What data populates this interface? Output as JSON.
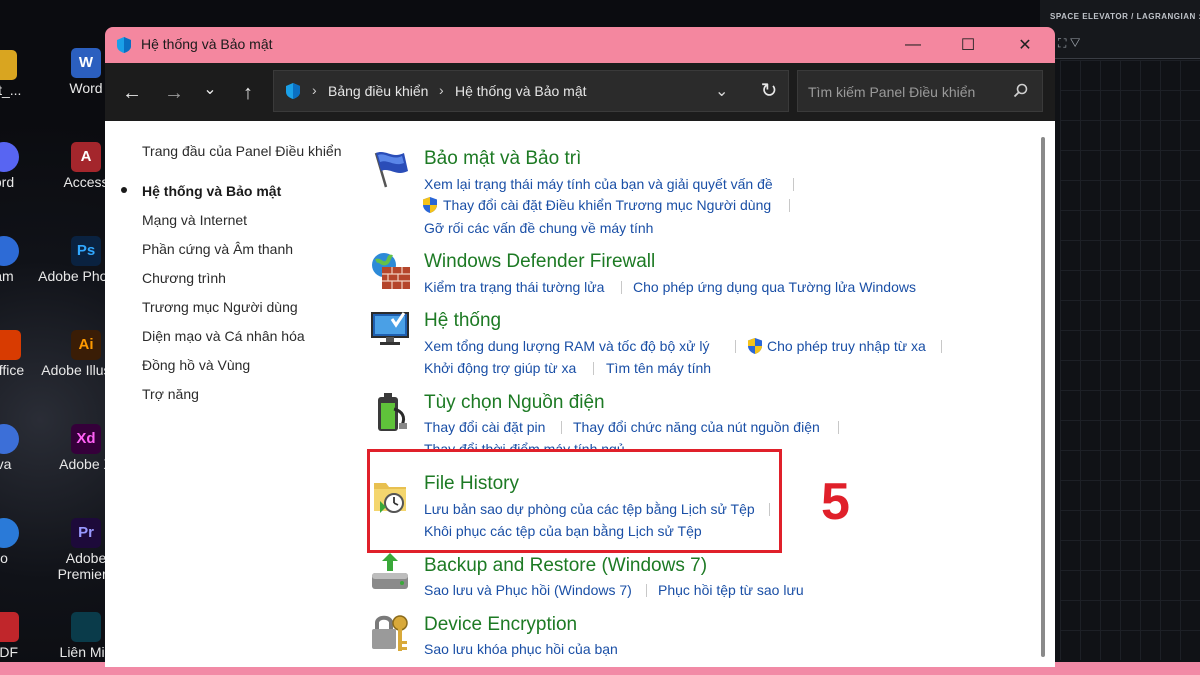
{
  "desktop": {
    "icons": [
      {
        "label": "ent_...",
        "color": "#d9a520",
        "glyph": ""
      },
      {
        "label": "Word",
        "color": "#2b5fbf",
        "glyph": "W"
      },
      {
        "label": "ord",
        "color": "#5865f2",
        "glyph": ""
      },
      {
        "label": "Access",
        "color": "#a4262c",
        "glyph": "A"
      },
      {
        "label": "am",
        "color": "#2d6bd6",
        "glyph": ""
      },
      {
        "label": "Adobe Photosh",
        "color": "#0a2240",
        "glyph": "Ps"
      },
      {
        "label": "Office",
        "color": "#d83b01",
        "glyph": ""
      },
      {
        "label": "Adobe Illustrat",
        "color": "#3a1d06",
        "glyph": "Ai"
      },
      {
        "label": "va",
        "color": "#3c6fd8",
        "glyph": ""
      },
      {
        "label": "Adobe X",
        "color": "#35003a",
        "glyph": "Xd"
      },
      {
        "label": "o",
        "color": "#2a7ad8",
        "glyph": ""
      },
      {
        "label": "Adobe Premiere",
        "color": "#1d0a3a",
        "glyph": "Pr"
      },
      {
        "label": "PDF",
        "color": "#c0262b",
        "glyph": ""
      },
      {
        "label": "Liên Min",
        "color": "#0a3b4a",
        "glyph": ""
      }
    ],
    "right_caption": "SPACE ELEVATOR / LAGRANGIAN : L",
    "right_glyphs": "⛶ ▽"
  },
  "window": {
    "title": "Hệ thống và Bảo mật",
    "controls": {
      "minimize": "—",
      "maximize": "☐",
      "close": "✕"
    },
    "nav": {
      "back": "←",
      "forward": "→",
      "recent": "⌄",
      "up": "↑",
      "refresh": "↻"
    },
    "breadcrumb": [
      "Bảng điều khiển",
      "Hệ thống và Bảo mật"
    ],
    "breadcrumb_sep": "›",
    "search_placeholder": "Tìm kiếm Panel Điều khiển"
  },
  "sidebar": {
    "items": [
      {
        "label": "Trang đầu của Panel Điều khiển",
        "active": false
      },
      {
        "label": "Hệ thống và Bảo mật",
        "active": true
      },
      {
        "label": "Mạng và Internet",
        "active": false
      },
      {
        "label": "Phần cứng và Âm thanh",
        "active": false
      },
      {
        "label": "Chương trình",
        "active": false
      },
      {
        "label": "Trương mục Người dùng",
        "active": false
      },
      {
        "label": "Diện mạo và Cá nhân hóa",
        "active": false
      },
      {
        "label": "Đồng hồ và Vùng",
        "active": false
      },
      {
        "label": "Trợ năng",
        "active": false
      }
    ]
  },
  "categories": [
    {
      "title": "Bảo mật và Bảo trì",
      "icon": "flag-icon",
      "links": [
        "Xem lại trạng thái máy tính của bạn và giải quyết vấn đề",
        "Thay đổi cài đặt Điều khiển Trương mục Người dùng",
        "Gỡ rối các vấn đề chung về máy tính"
      ]
    },
    {
      "title": "Windows Defender Firewall",
      "icon": "firewall-icon",
      "links": [
        "Kiểm tra trạng thái tường lửa",
        "Cho phép ứng dụng qua Tường lửa Windows"
      ]
    },
    {
      "title": "Hệ thống",
      "icon": "monitor-icon",
      "links": [
        "Xem tổng dung lượng RAM và tốc độ bộ xử lý",
        "Cho phép truy nhập từ xa",
        "Khởi động trợ giúp từ xa",
        "Tìm tên máy tính"
      ]
    },
    {
      "title": "Tùy chọn Nguồn điện",
      "icon": "battery-icon",
      "links": [
        "Thay đổi cài đặt pin",
        "Thay đổi chức năng của nút nguồn điện",
        "Thay đổi thời điểm máy tính ngủ"
      ]
    },
    {
      "title": "File History",
      "icon": "file-history-icon",
      "links": [
        "Lưu bản sao dự phòng của các tệp bằng Lịch sử Tệp",
        "Khôi phục các tệp của bạn bằng Lịch sử Tệp"
      ]
    },
    {
      "title": "Backup and Restore (Windows 7)",
      "icon": "backup-icon",
      "links": [
        "Sao lưu và Phục hồi (Windows 7)",
        "Phục hồi tệp từ sao lưu"
      ]
    },
    {
      "title": "Device Encryption",
      "icon": "key-lock-icon",
      "links": [
        "Sao lưu khóa phục hồi của bạn"
      ]
    }
  ],
  "annotation": {
    "step_number": "5",
    "color": "#e0202a"
  },
  "colors": {
    "accent_pink": "#f4879f",
    "link_blue": "#1a4fa6",
    "title_green": "#1d7a24"
  }
}
